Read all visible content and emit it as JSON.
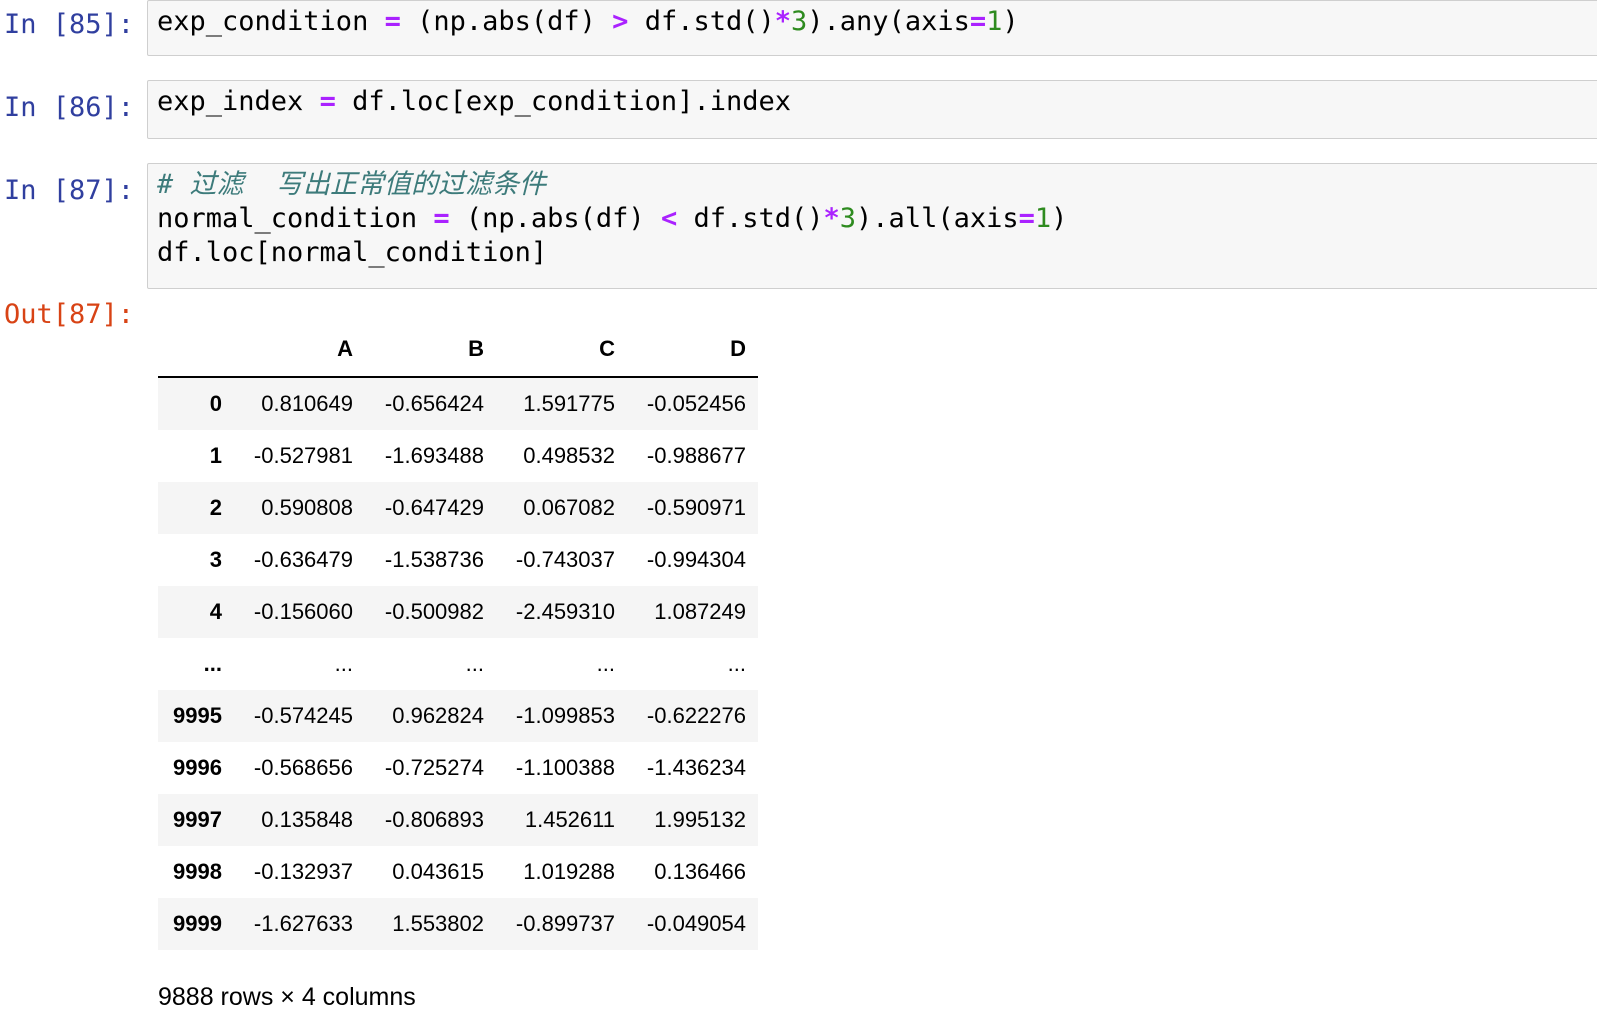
{
  "cells": [
    {
      "prompt": "In [85]:",
      "lines": [
        [
          {
            "t": "exp_condition ",
            "c": ""
          },
          {
            "t": "=",
            "c": "op"
          },
          {
            "t": " (np.abs(df) ",
            "c": ""
          },
          {
            "t": ">",
            "c": "op"
          },
          {
            "t": " df.std()",
            "c": ""
          },
          {
            "t": "*",
            "c": "op"
          },
          {
            "t": "3",
            "c": "num"
          },
          {
            "t": ").any(axis",
            "c": ""
          },
          {
            "t": "=",
            "c": "op"
          },
          {
            "t": "1",
            "c": "num"
          },
          {
            "t": ")",
            "c": ""
          }
        ]
      ]
    },
    {
      "prompt": "In [86]:",
      "lines": [
        [
          {
            "t": "exp_index ",
            "c": ""
          },
          {
            "t": "=",
            "c": "op"
          },
          {
            "t": " df.loc[exp_condition].index",
            "c": ""
          }
        ]
      ]
    },
    {
      "prompt": "In [87]:",
      "lines": [
        [
          {
            "t": "# 过滤  写出正常值的过滤条件",
            "c": "comment"
          }
        ],
        [
          {
            "t": "normal_condition ",
            "c": ""
          },
          {
            "t": "=",
            "c": "op"
          },
          {
            "t": " (np.abs(df) ",
            "c": ""
          },
          {
            "t": "<",
            "c": "op"
          },
          {
            "t": " df.std()",
            "c": ""
          },
          {
            "t": "*",
            "c": "op"
          },
          {
            "t": "3",
            "c": "num"
          },
          {
            "t": ").all(axis",
            "c": ""
          },
          {
            "t": "=",
            "c": "op"
          },
          {
            "t": "1",
            "c": "num"
          },
          {
            "t": ")",
            "c": ""
          }
        ],
        [
          {
            "t": "df.loc[normal_condition]",
            "c": ""
          }
        ]
      ]
    }
  ],
  "output": {
    "prompt": "Out[87]:",
    "columns": [
      "A",
      "B",
      "C",
      "D"
    ],
    "rows": [
      {
        "index": "0",
        "values": [
          "0.810649",
          "-0.656424",
          "1.591775",
          "-0.052456"
        ]
      },
      {
        "index": "1",
        "values": [
          "-0.527981",
          "-1.693488",
          "0.498532",
          "-0.988677"
        ]
      },
      {
        "index": "2",
        "values": [
          "0.590808",
          "-0.647429",
          "0.067082",
          "-0.590971"
        ]
      },
      {
        "index": "3",
        "values": [
          "-0.636479",
          "-1.538736",
          "-0.743037",
          "-0.994304"
        ]
      },
      {
        "index": "4",
        "values": [
          "-0.156060",
          "-0.500982",
          "-2.459310",
          "1.087249"
        ]
      },
      {
        "index": "...",
        "values": [
          "...",
          "...",
          "...",
          "..."
        ]
      },
      {
        "index": "9995",
        "values": [
          "-0.574245",
          "0.962824",
          "-1.099853",
          "-0.622276"
        ]
      },
      {
        "index": "9996",
        "values": [
          "-0.568656",
          "-0.725274",
          "-1.100388",
          "-1.436234"
        ]
      },
      {
        "index": "9997",
        "values": [
          "0.135848",
          "-0.806893",
          "1.452611",
          "1.995132"
        ]
      },
      {
        "index": "9998",
        "values": [
          "-0.132937",
          "0.043615",
          "1.019288",
          "0.136466"
        ]
      },
      {
        "index": "9999",
        "values": [
          "-1.627633",
          "1.553802",
          "-0.899737",
          "-0.049054"
        ]
      }
    ],
    "shape": "9888 rows × 4 columns"
  }
}
